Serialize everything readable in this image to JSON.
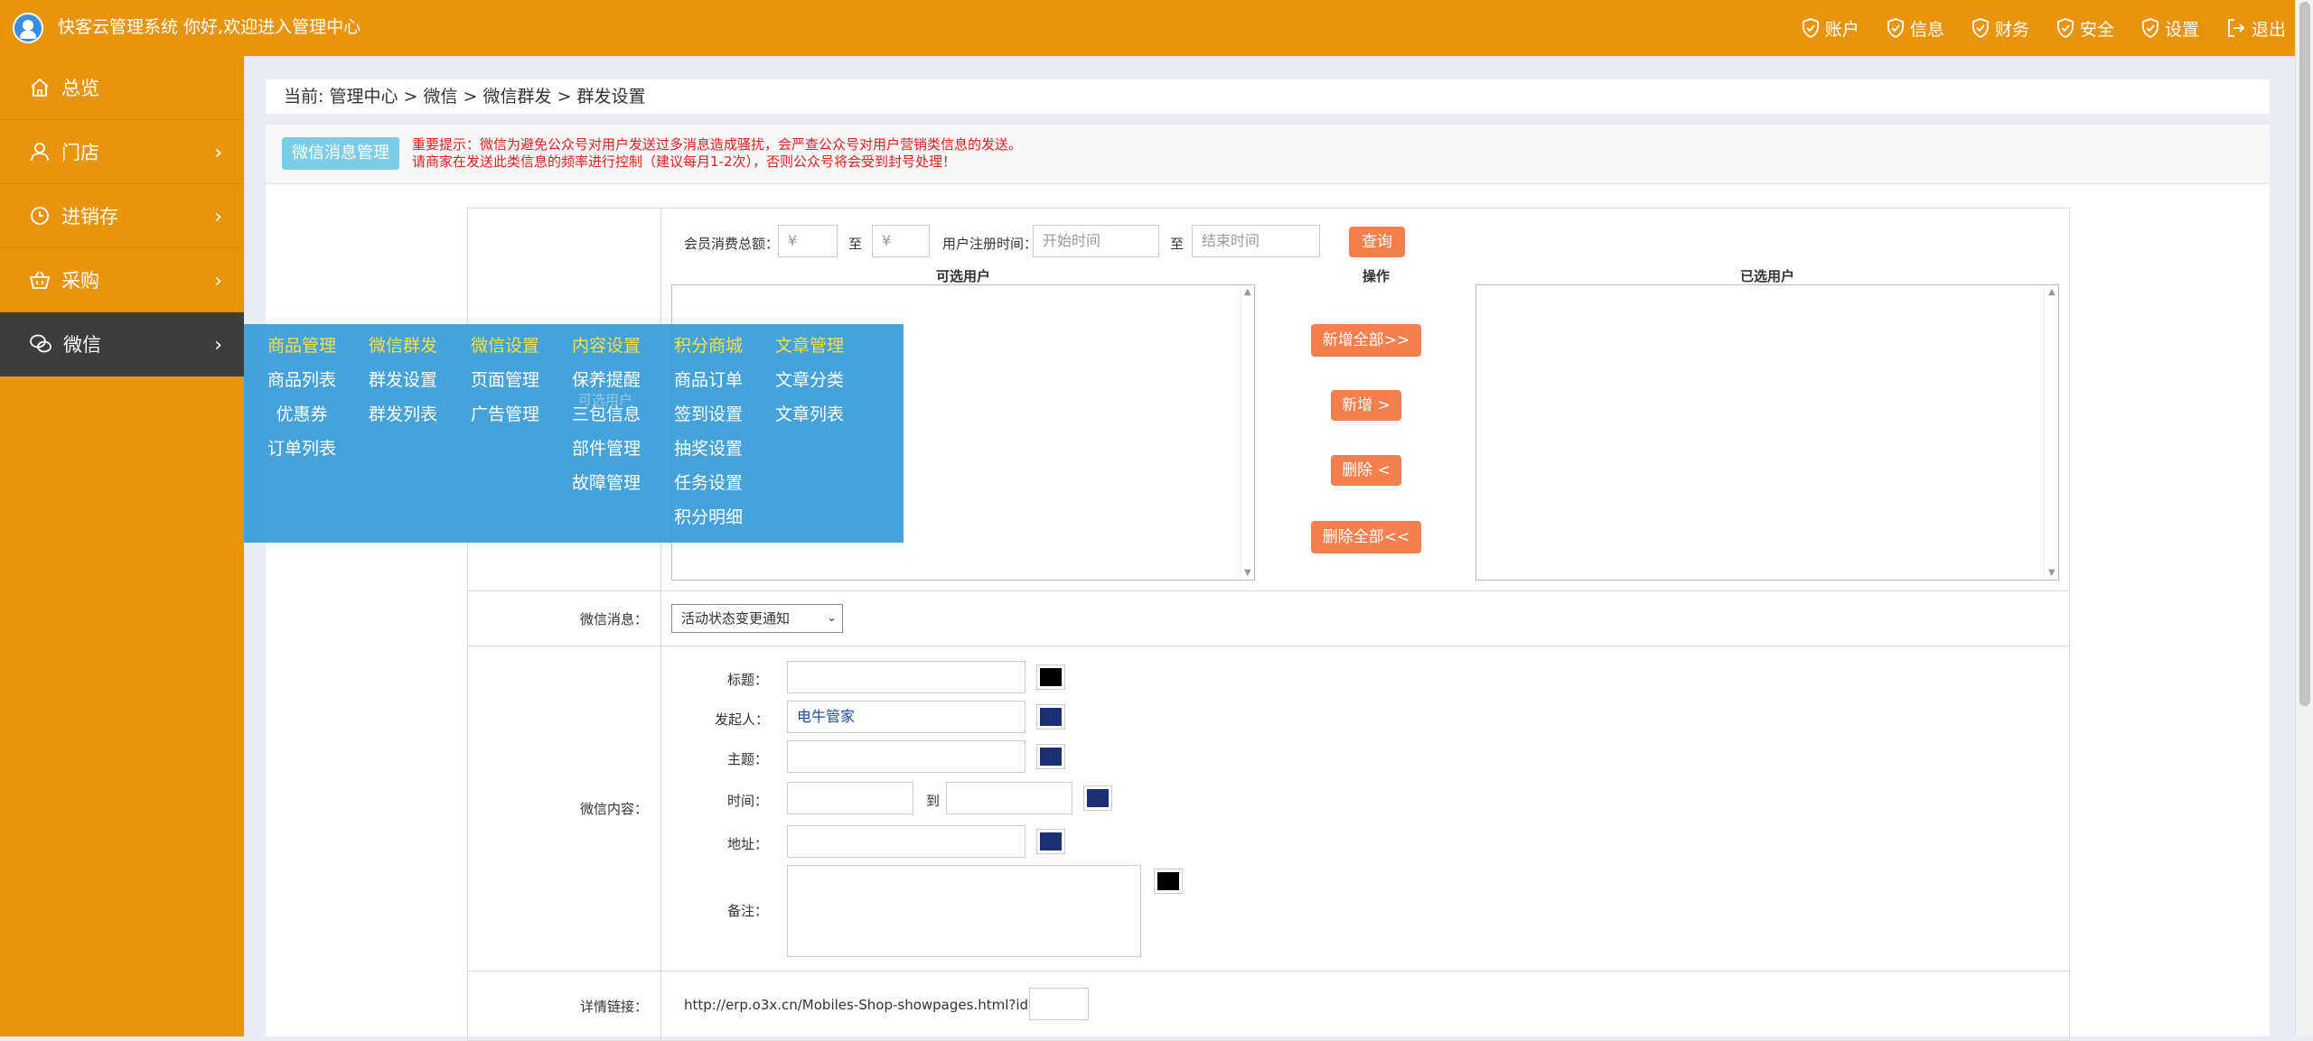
{
  "app": {
    "title": "快客云管理系统 你好,欢迎进入管理中心"
  },
  "topnav": [
    {
      "label": "账户",
      "icon": "shield-check-icon"
    },
    {
      "label": "信息",
      "icon": "shield-check-icon"
    },
    {
      "label": "财务",
      "icon": "shield-check-icon"
    },
    {
      "label": "安全",
      "icon": "shield-check-icon"
    },
    {
      "label": "设置",
      "icon": "shield-check-icon"
    },
    {
      "label": "退出",
      "icon": "logout-icon"
    }
  ],
  "sidebar": {
    "items": [
      {
        "label": "总览",
        "icon": "home-icon"
      },
      {
        "label": "门店",
        "icon": "user-icon"
      },
      {
        "label": "进销存",
        "icon": "clock-icon"
      },
      {
        "label": "采购",
        "icon": "basket-icon"
      },
      {
        "label": "微信",
        "icon": "wechat-icon"
      }
    ]
  },
  "breadcrumb": "当前: 管理中心 > 微信 > 微信群发 > 群发设置",
  "tip": {
    "button": "微信消息管理",
    "line1": "重要提示：微信为避免公众号对用户发送过多消息造成骚扰，会严查公众号对用户营销类信息的发送。",
    "line2": "请商家在发送此类信息的频率进行控制（建议每月1-2次），否则公众号将会受到封号处理！"
  },
  "filter": {
    "spend_label": "会员消费总额：",
    "spend_from": "¥",
    "to": "至",
    "spend_to": "¥",
    "reg_label": "用户注册时间：",
    "start_placeholder": "开始时间",
    "end_placeholder": "结束时间",
    "query": "查询"
  },
  "users": {
    "available_header": "可选用户",
    "ops_header": "操作",
    "selected_header": "已选用户",
    "add_all": "新增全部>>",
    "add": "新增 >",
    "remove": "删除 <",
    "remove_all": "删除全部<<",
    "ghost_label": "可选用户"
  },
  "message": {
    "label": "微信消息：",
    "selected": "活动状态变更通知"
  },
  "content": {
    "label": "微信内容：",
    "title_label": "标题：",
    "sender_label": "发起人：",
    "sender_value": "电牛管家",
    "subject_label": "主题：",
    "time_label": "时间：",
    "time_to": "到",
    "address_label": "地址：",
    "remark_label": "备注："
  },
  "link": {
    "label": "详情链接：",
    "prefix": "http://erp.o3x.cn/Mobiles-Shop-showpages.html?id="
  },
  "colors": {
    "black_swatch": "#000000",
    "navy_swatch": "#1b2f72",
    "accent": "#e8940f",
    "flyout": "#389cd6"
  },
  "flyout": {
    "columns": [
      {
        "header": "商品管理",
        "items": [
          "商品列表",
          "优惠券",
          "订单列表"
        ]
      },
      {
        "header": "微信群发",
        "items": [
          "群发设置",
          "群发列表"
        ]
      },
      {
        "header": "微信设置",
        "items": [
          "页面管理",
          "广告管理"
        ]
      },
      {
        "header": "内容设置",
        "items": [
          "保养提醒",
          "三包信息",
          "部件管理",
          "故障管理"
        ]
      },
      {
        "header": "积分商城",
        "items": [
          "商品订单",
          "签到设置",
          "抽奖设置",
          "任务设置",
          "积分明细"
        ]
      },
      {
        "header": "文章管理",
        "items": [
          "文章分类",
          "文章列表"
        ]
      }
    ]
  }
}
